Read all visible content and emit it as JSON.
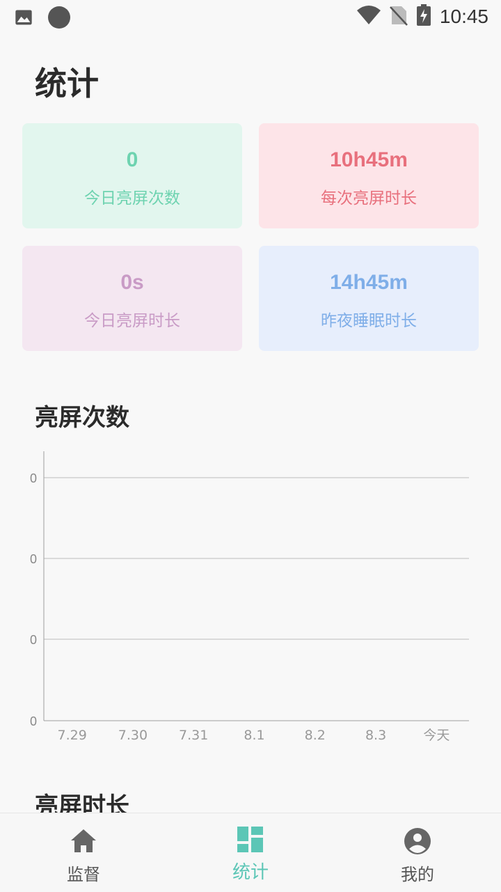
{
  "status_bar": {
    "time": "10:45",
    "icons": [
      "image-icon",
      "circle-icon",
      "wifi-icon",
      "no-sim-icon",
      "battery-charging-icon"
    ]
  },
  "page": {
    "title": "统计"
  },
  "cards": [
    {
      "value": "0",
      "label": "今日亮屏次数",
      "color": "#6ed3b0"
    },
    {
      "value": "10h45m",
      "label": "每次亮屏时长",
      "color": "#e8707d"
    },
    {
      "value": "0s",
      "label": "今日亮屏时长",
      "color": "#c99bc6"
    },
    {
      "value": "14h45m",
      "label": "昨夜睡眠时长",
      "color": "#7faee8"
    }
  ],
  "sections": {
    "screen_on_count_title": "亮屏次数",
    "screen_on_duration_title": "亮屏时长"
  },
  "chart_data": {
    "type": "line",
    "title": "亮屏次数",
    "categories": [
      "7.29",
      "7.30",
      "7.31",
      "8.1",
      "8.2",
      "8.3",
      "今天"
    ],
    "series": [
      {
        "values": [
          0,
          0,
          0,
          0,
          0,
          0,
          0
        ]
      }
    ],
    "y_tick_labels": [
      "0",
      "0",
      "0",
      "0"
    ],
    "grid": true
  },
  "bottom_nav": {
    "items": [
      {
        "label": "监督",
        "icon": "home-icon",
        "active": false
      },
      {
        "label": "统计",
        "icon": "dashboard-icon",
        "active": true
      },
      {
        "label": "我的",
        "icon": "account-circle-icon",
        "active": false
      }
    ],
    "active_color": "#5cc6b6",
    "inactive_color": "#666666"
  }
}
